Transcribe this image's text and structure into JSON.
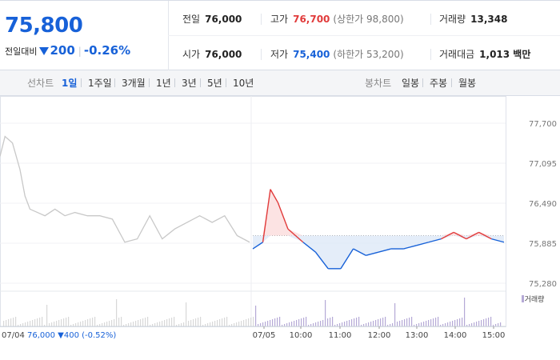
{
  "summary": {
    "current_price": "75,800",
    "change_label": "전일대비",
    "change_amount": "200",
    "change_rate": "-0.26%",
    "prev_close_label": "전일",
    "prev_close": "76,000",
    "high_label": "고가",
    "high": "76,700",
    "upper_limit": "(상한가 98,800)",
    "volume_label": "거래량",
    "volume": "13,348",
    "open_label": "시가",
    "open": "76,000",
    "low_label": "저가",
    "low": "75,400",
    "lower_limit": "(하한가 53,200)",
    "amount_label": "거래대금",
    "amount": "1,013 백만"
  },
  "toolbar": {
    "line_chart_label": "선차트",
    "periods": [
      "1일",
      "1주일",
      "3개월",
      "1년",
      "3년",
      "5년",
      "10년"
    ],
    "active_period": "1일",
    "candle_chart_label": "봉차트",
    "candle_periods": [
      "일봉",
      "주봉",
      "월봉"
    ]
  },
  "chart_data": {
    "type": "line",
    "y_ticks": [
      "77,700",
      "77,095",
      "76,490",
      "75,885",
      "75,280"
    ],
    "ylim": [
      75280,
      77700
    ],
    "reference_price": 76000,
    "x_tick_labels": [
      "07/05",
      "10:00",
      "11:00",
      "12:00",
      "13:00",
      "14:00",
      "15:00"
    ],
    "volume_legend": "거래량",
    "prev_day_caption": {
      "date": "07/04",
      "close": "76,000",
      "change": "▼400",
      "rate": "(-0.52%)"
    },
    "series": [
      {
        "x": [
          0,
          0.02,
          0.05,
          0.08,
          0.1,
          0.12,
          0.15,
          0.18,
          0.22,
          0.26,
          0.3,
          0.35,
          0.4,
          0.45,
          0.5,
          0.55,
          0.6,
          0.65,
          0.7,
          0.75,
          0.8,
          0.85,
          0.9,
          0.95,
          1.0
        ],
        "y": [
          77200,
          77500,
          77400,
          77000,
          76600,
          76400,
          76350,
          76300,
          76400,
          76300,
          76350,
          76300,
          76300,
          76250,
          75900,
          75950,
          76300,
          75950,
          76100,
          76200,
          76300,
          76200,
          76300,
          76000,
          75900
        ]
      },
      {
        "x": [
          0,
          0.04,
          0.07,
          0.1,
          0.14,
          0.2,
          0.25,
          0.3,
          0.35,
          0.4,
          0.45,
          0.5,
          0.55,
          0.6,
          0.65,
          0.7,
          0.75,
          0.8,
          0.85,
          0.9,
          0.95,
          1.0
        ],
        "y": [
          75800,
          75900,
          76700,
          76500,
          76100,
          75900,
          75750,
          75500,
          75500,
          75800,
          75700,
          75750,
          75800,
          75800,
          75850,
          75900,
          75950,
          76050,
          75950,
          76050,
          75950,
          75900
        ]
      }
    ]
  },
  "colors": {
    "up": "#e13b3b",
    "down": "#1761d8",
    "prev": "#c8c8c8",
    "volume": "#b5a9d6"
  }
}
